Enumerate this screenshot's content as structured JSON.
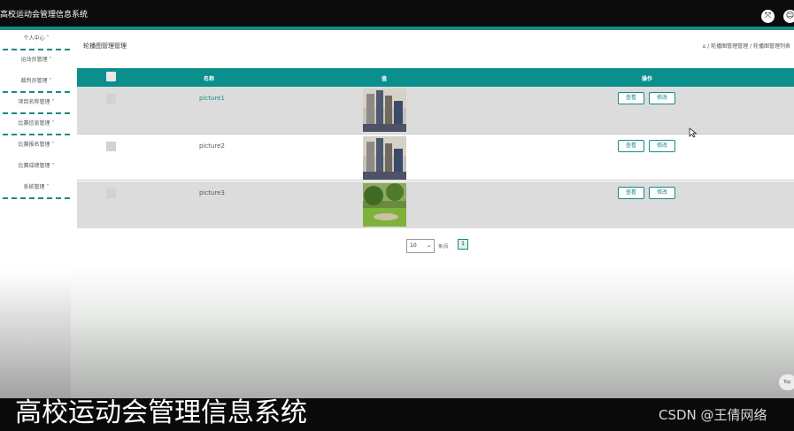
{
  "app": {
    "title": "高校运动会管理信息系统"
  },
  "header_icons": [
    "collapse-icon",
    "user-icon"
  ],
  "sidebar": {
    "items": [
      {
        "label": "个人中心 ˅"
      },
      {
        "label": "运动员管理 ˅"
      },
      {
        "label": "裁判员管理 ˅"
      },
      {
        "label": "项目名称管理 ˅"
      },
      {
        "label": "比赛信息管理 ˅"
      },
      {
        "label": "比赛报名管理 ˅"
      },
      {
        "label": "比赛成绩管理 ˅"
      },
      {
        "label": "系统管理 ˅"
      }
    ]
  },
  "breadcrumb": {
    "page_title": "轮播图管理管理",
    "path": "⌂ / 轮播图管理管理 / 轮播图管理列表"
  },
  "table": {
    "columns": {
      "name": "名称",
      "value": "值",
      "actions": "操作"
    },
    "rows": [
      {
        "name": "picture1",
        "image": "building-photo",
        "view": "查看",
        "edit": "修改"
      },
      {
        "name": "picture2",
        "image": "building-photo",
        "view": "查看",
        "edit": "修改"
      },
      {
        "name": "picture3",
        "image": "park-photo",
        "view": "查看",
        "edit": "修改"
      }
    ]
  },
  "pagination": {
    "page_size": "10",
    "per_page_label": "条/页",
    "current_page": "1"
  },
  "scroll_top": {
    "label": "Top"
  },
  "footer": {
    "title": "高校运动会管理信息系统",
    "watermark": "CSDN @王倩网络"
  },
  "colors": {
    "accent": "#1a8a84",
    "header_bg": "#0b8f8d",
    "topbar": "#0c0c0c"
  }
}
